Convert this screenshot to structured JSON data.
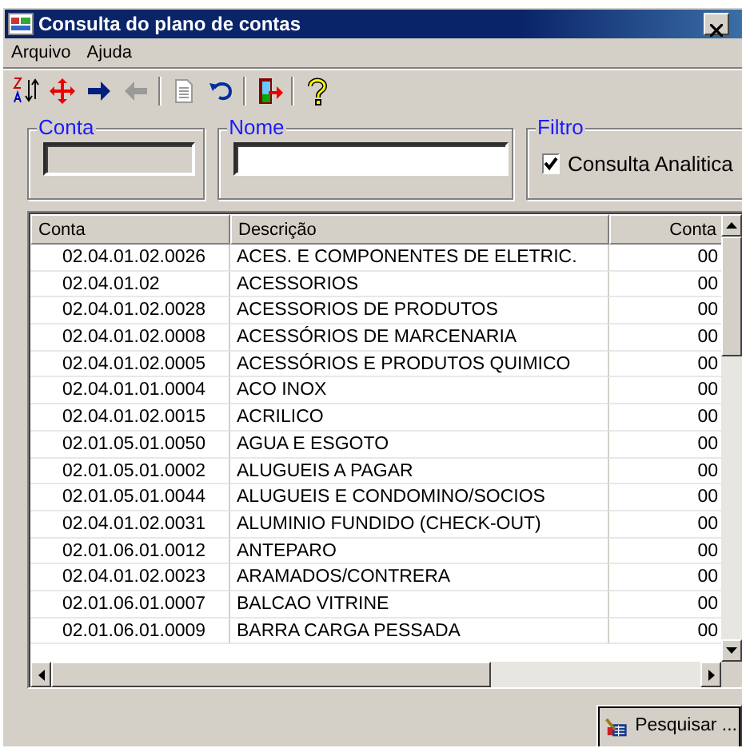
{
  "window": {
    "title": "Consulta do plano de contas"
  },
  "menu": [
    {
      "label": "Arquivo"
    },
    {
      "label": "Ajuda"
    }
  ],
  "toolbar": [
    {
      "kind": "sort"
    },
    {
      "kind": "move"
    },
    {
      "kind": "next",
      "disabled": false
    },
    {
      "kind": "prev",
      "disabled": true
    },
    {
      "kind": "sep"
    },
    {
      "kind": "document",
      "disabled": true
    },
    {
      "kind": "undo",
      "disabled": false
    },
    {
      "kind": "sep"
    },
    {
      "kind": "exit"
    },
    {
      "kind": "sep"
    },
    {
      "kind": "help"
    }
  ],
  "filters": {
    "conta": {
      "legend": "Conta",
      "disabled": true
    },
    "nome": {
      "legend": "Nome",
      "disabled": false
    },
    "filtro": {
      "legend": "Filtro",
      "label": "Consulta Analitica",
      "checked": true
    }
  },
  "table": {
    "columns": [
      "Conta",
      "Descrição",
      "Conta"
    ],
    "rows": [
      [
        "02.04.01.02.0026",
        "ACES. E COMPONENTES DE ELETRIC.",
        "00"
      ],
      [
        "02.04.01.02",
        "ACESSORIOS",
        "00"
      ],
      [
        "02.04.01.02.0028",
        "ACESSORIOS DE PRODUTOS",
        "00"
      ],
      [
        "02.04.01.02.0008",
        "ACESSÓRIOS DE MARCENARIA",
        "00"
      ],
      [
        "02.04.01.02.0005",
        "ACESSÓRIOS E PRODUTOS QUIMICO",
        "00"
      ],
      [
        "02.04.01.01.0004",
        "ACO INOX",
        "00"
      ],
      [
        "02.04.01.02.0015",
        "ACRILICO",
        "00"
      ],
      [
        "02.01.05.01.0050",
        "AGUA E ESGOTO",
        "00"
      ],
      [
        "02.01.05.01.0002",
        "ALUGUEIS A PAGAR",
        "00"
      ],
      [
        "02.01.05.01.0044",
        "ALUGUEIS E CONDOMINO/SOCIOS",
        "00"
      ],
      [
        "02.04.01.02.0031",
        "ALUMINIO FUNDIDO (CHECK-OUT)",
        "00"
      ],
      [
        "02.01.06.01.0012",
        "ANTEPARO",
        "00"
      ],
      [
        "02.04.01.02.0023",
        "ARAMADOS/CONTRERA",
        "00"
      ],
      [
        "02.01.06.01.0007",
        "BALCAO VITRINE",
        "00"
      ],
      [
        "02.01.06.01.0009",
        "BARRA CARGA PESSADA",
        "00"
      ]
    ]
  },
  "search_button": {
    "label": "Pesquisar ..."
  }
}
